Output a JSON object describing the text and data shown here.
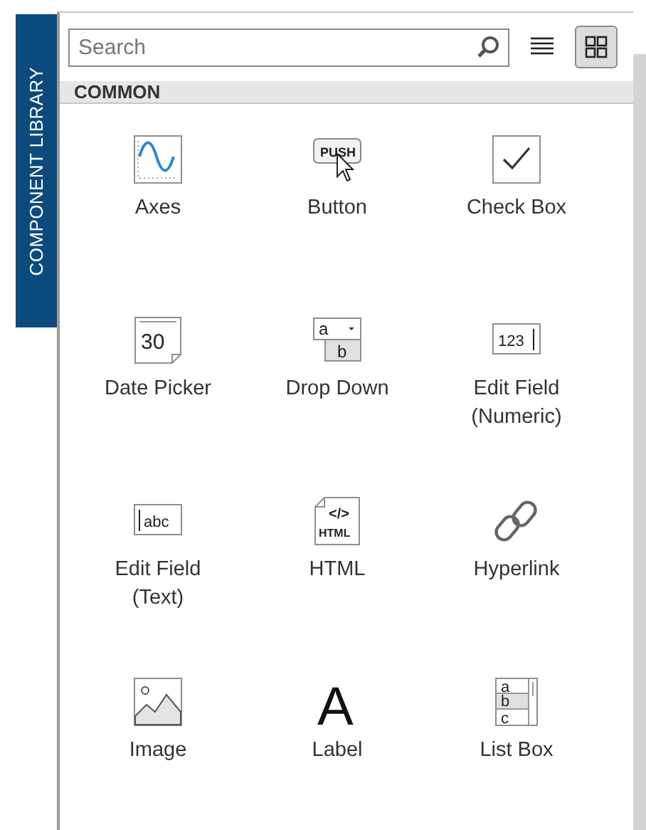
{
  "side_tab": {
    "label": "COMPONENT LIBRARY"
  },
  "search": {
    "placeholder": "Search"
  },
  "view_buttons": [
    {
      "kind": "list",
      "selected": false
    },
    {
      "kind": "grid",
      "selected": true
    }
  ],
  "section": {
    "title": "COMMON"
  },
  "components": [
    {
      "kind": "axes",
      "label": "Axes"
    },
    {
      "kind": "button",
      "label": "Button",
      "icon_text": [
        "PUSH"
      ]
    },
    {
      "kind": "checkbox",
      "label": "Check Box"
    },
    {
      "kind": "datepicker",
      "label": "Date Picker",
      "icon_text": [
        "30"
      ]
    },
    {
      "kind": "dropdown",
      "label": "Drop Down",
      "icon_text": [
        "a",
        "b"
      ]
    },
    {
      "kind": "numeric",
      "label": "Edit Field (Numeric)",
      "icon_text": [
        "123"
      ]
    },
    {
      "kind": "textfield",
      "label": "Edit Field (Text)",
      "icon_text": [
        "abc"
      ]
    },
    {
      "kind": "html",
      "label": "HTML",
      "icon_text": [
        "</>",
        "HTML"
      ]
    },
    {
      "kind": "hyperlink",
      "label": "Hyperlink"
    },
    {
      "kind": "image",
      "label": "Image"
    },
    {
      "kind": "label",
      "label": "Label",
      "icon_text": [
        "A"
      ]
    },
    {
      "kind": "listbox",
      "label": "List Box",
      "icon_text": [
        "a",
        "b",
        "c"
      ]
    }
  ]
}
